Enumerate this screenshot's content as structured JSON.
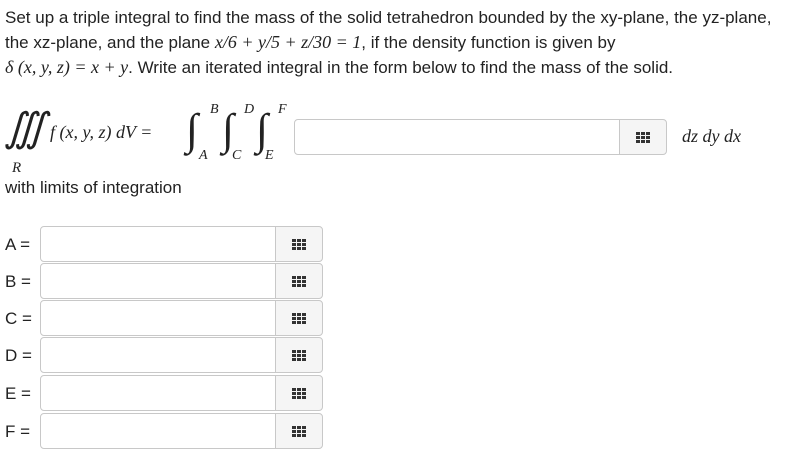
{
  "problem": {
    "line1": "Set up a triple integral to find the mass of the solid tetrahedron bounded by the xy-plane, the yz-plane,",
    "line2_pre": "the xz-plane, and the plane ",
    "plane_eq": "x/6 + y/5 + z/30 = 1",
    "line2_post": ", if the density function is given by",
    "density_eq": "δ (x, y, z) = x + y",
    "line3_post": ". Write an iterated integral in the form below to find the mass of the solid."
  },
  "integral": {
    "triple_symbol": "∭",
    "region": "R",
    "integrand_left": "f (x, y, z) dV =",
    "lower_1": "A",
    "upper_1": "B",
    "lower_2": "C",
    "upper_2": "D",
    "lower_3": "E",
    "upper_3": "F",
    "integrand_value": "",
    "differentials": "dz dy dx"
  },
  "with_limits_text": "with limits of integration",
  "limits": [
    {
      "label": "A =",
      "value": ""
    },
    {
      "label": "B =",
      "value": ""
    },
    {
      "label": "C =",
      "value": ""
    },
    {
      "label": "D =",
      "value": ""
    },
    {
      "label": "E =",
      "value": ""
    },
    {
      "label": "F =",
      "value": ""
    }
  ],
  "palette_icon": "grid-icon"
}
